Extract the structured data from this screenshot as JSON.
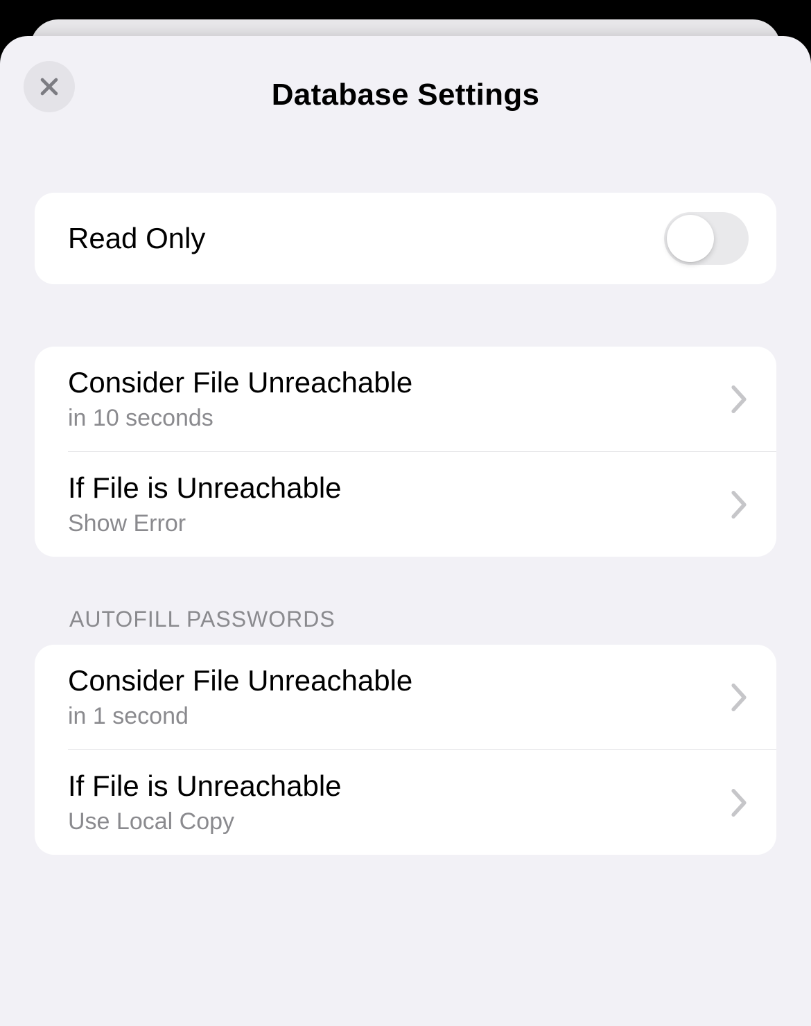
{
  "header": {
    "title": "Database Settings"
  },
  "group1": {
    "read_only": {
      "label": "Read Only",
      "enabled": false
    }
  },
  "group2": {
    "items": [
      {
        "title": "Consider File Unreachable",
        "sub": "in 10 seconds"
      },
      {
        "title": "If File is Unreachable",
        "sub": "Show Error"
      }
    ]
  },
  "section_autofill": {
    "header": "AUTOFILL PASSWORDS",
    "items": [
      {
        "title": "Consider File Unreachable",
        "sub": "in 1 second"
      },
      {
        "title": "If File is Unreachable",
        "sub": "Use Local Copy"
      }
    ]
  }
}
